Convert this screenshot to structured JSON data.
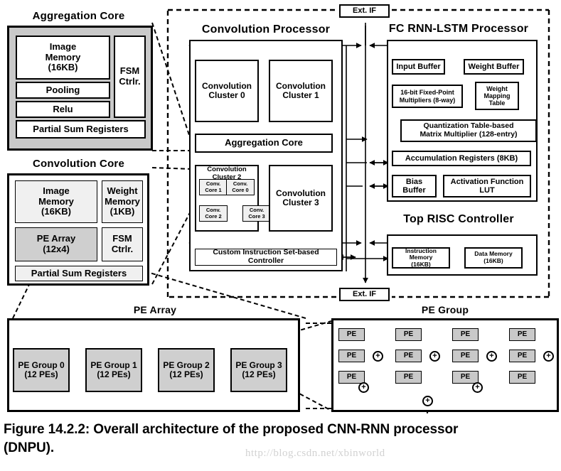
{
  "figure": {
    "caption_line1": "Figure 14.2.2: Overall architecture of the proposed CNN-RNN processor",
    "caption_line2": "(DNPU).",
    "watermark": "http://blog.csdn.net/xbinworld"
  },
  "colors": {
    "outline": "#000000",
    "aggregation_core_fill": "#c9c9c9",
    "inner_light": "#f0f0f0",
    "pe_array_fill": "#cfcfcf",
    "pe_group_fill": "#c9c9c9",
    "white": "#ffffff",
    "watermark": "#d2d2d2"
  },
  "aggregation_core": {
    "title": "Aggregation Core",
    "image_memory": "Image\nMemory\n(16KB)",
    "image_memory_lines": [
      "Image",
      "Memory",
      "(16KB)"
    ],
    "pooling": "Pooling",
    "relu": "Relu",
    "fsm_ctrl_lines": [
      "FSM",
      "Ctrlr."
    ],
    "partial_sum_registers": "Partial Sum Registers"
  },
  "convolution_core": {
    "title": "Convolution Core",
    "image_memory_lines": [
      "Image",
      "Memory",
      "(16KB)"
    ],
    "weight_memory_lines": [
      "Weight",
      "Memory",
      "(1KB)"
    ],
    "pe_array_lines": [
      "PE Array",
      "(12x4)"
    ],
    "fsm_ctrl_lines": [
      "FSM",
      "Ctrlr."
    ],
    "partial_sum_registers": "Partial Sum Registers"
  },
  "convolution_processor": {
    "title": "Convolution Processor",
    "cluster0_lines": [
      "Convolution",
      "Cluster 0"
    ],
    "cluster1_lines": [
      "Convolution",
      "Cluster 1"
    ],
    "cluster2_lines": [
      "Convolution",
      "Cluster 2"
    ],
    "cluster3_lines": [
      "Convolution",
      "Cluster 3"
    ],
    "aggregation_core": "Aggregation Core",
    "controller": "Custom Instruction Set-based Controller",
    "conv_cores": [
      {
        "lines": [
          "Conv.",
          "Core 1"
        ]
      },
      {
        "lines": [
          "Conv.",
          "Core 0"
        ]
      },
      {
        "lines": [
          "Conv.",
          "Core 2"
        ]
      },
      {
        "lines": [
          "Conv.",
          "Core 3"
        ]
      }
    ]
  },
  "fc_rnn_lstm_processor": {
    "title": "FC RNN-LSTM Processor",
    "input_buffer": "Input Buffer",
    "weight_buffer": "Weight Buffer",
    "multipliers_lines": [
      "16-bit Fixed-Point",
      "Multipliers (8-way)"
    ],
    "weight_mapping_table_lines": [
      "Weight",
      "Mapping",
      "Table"
    ],
    "matrix_multiplier_lines": [
      "Quantization Table-based",
      "Matrix Multiplier (128-entry)"
    ],
    "accumulation_registers": "Accumulation Registers (8KB)",
    "bias_buffer_lines": [
      "Bias",
      "Buffer"
    ],
    "activation_lut_lines": [
      "Activation Function",
      "LUT"
    ]
  },
  "top_risc_controller": {
    "title": "Top RISC Controller",
    "instruction_memory_lines": [
      "Instruction Memory",
      "(16KB)"
    ],
    "data_memory_lines": [
      "Data Memory",
      "(16KB)"
    ]
  },
  "ext_if": {
    "top_label": "Ext. IF",
    "bottom_label": "Ext. IF"
  },
  "pe_array": {
    "title": "PE Array",
    "groups": [
      {
        "lines": [
          "PE Group 0",
          "(12 PEs)"
        ]
      },
      {
        "lines": [
          "PE Group 1",
          "(12 PEs)"
        ]
      },
      {
        "lines": [
          "PE Group 2",
          "(12 PEs)"
        ]
      },
      {
        "lines": [
          "PE Group 3",
          "(12 PEs)"
        ]
      }
    ]
  },
  "pe_group": {
    "title": "PE Group",
    "pe_label": "PE",
    "adder_symbol": "+",
    "columns": 4,
    "pes_per_column": 3,
    "adders_per_column": 1,
    "second_stage_adders": 2,
    "final_adders": 1
  }
}
